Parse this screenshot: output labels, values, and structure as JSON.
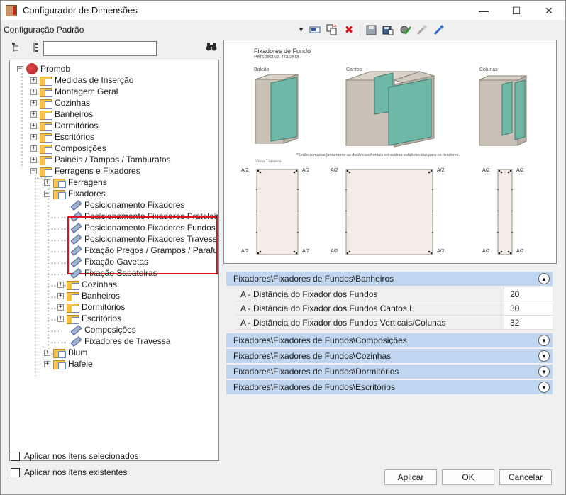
{
  "window": {
    "title": "Configurador de Dimensões"
  },
  "toolbar": {
    "config_value": "Configuração Padrão"
  },
  "tree": {
    "root": "Promob",
    "level1": [
      "Medidas de Inserção",
      "Montagem Geral",
      "Cozinhas",
      "Banheiros",
      "Dormitórios",
      "Escritórios",
      "Composições",
      "Painéis / Tampos / Tamburatos",
      "Ferragens e Fixadores"
    ],
    "ferragens": "Ferragens",
    "fixadores": "Fixadores",
    "highlighted": [
      "Posicionamento Fixadores",
      "Posicionamento Fixadores Prateleiras",
      "Posicionamento Fixadores Fundos",
      "Posicionamento Fixadores Travessas",
      "Fixação Pregos / Grampos / Parafusos"
    ],
    "after": [
      "Fixação Gavetas",
      "Fixação Sapateiras"
    ],
    "subfolders": [
      "Cozinhas",
      "Banheiros",
      "Dormitórios",
      "Escritórios"
    ],
    "leaves2": [
      "Composições",
      "Fixadores de Travessa"
    ],
    "tail": [
      "Blum",
      "Hafele"
    ]
  },
  "options": {
    "selected": "Aplicar nos itens selecionados",
    "existing": "Aplicar nos itens existentes"
  },
  "preview": {
    "title": "Fixadores de Fundo",
    "subtitle": "Perspectiva Traseira",
    "labels": [
      "Balcão",
      "Cantos",
      "Colunas"
    ],
    "note": "*Serão somadas juntamente as distâncias frontais e traseiras estabelecidas para os fixadores.",
    "vista": "Vista Traseira",
    "dim": "A/2"
  },
  "grid": {
    "expanded_category": "Fixadores\\Fixadores de Fundos\\Banheiros",
    "rows": [
      {
        "name": "A - Distância do Fixador dos Fundos",
        "value": "20"
      },
      {
        "name": "A - Distância do Fixador dos Fundos Cantos L",
        "value": "30"
      },
      {
        "name": "A - Distância do Fixador dos Fundos Verticais/Colunas",
        "value": "32"
      }
    ],
    "collapsed": [
      "Fixadores\\Fixadores de Fundos\\Composições",
      "Fixadores\\Fixadores de Fundos\\Cozinhas",
      "Fixadores\\Fixadores de Fundos\\Dormitórios",
      "Fixadores\\Fixadores de Fundos\\Escritórios"
    ]
  },
  "buttons": {
    "apply": "Aplicar",
    "ok": "OK",
    "cancel": "Cancelar"
  },
  "colors": {
    "category_bar": "#c0d5ef",
    "highlight_border": "#e0141e",
    "panel_green": "#6fb8a8",
    "cabinet": "#cfc7bd"
  }
}
